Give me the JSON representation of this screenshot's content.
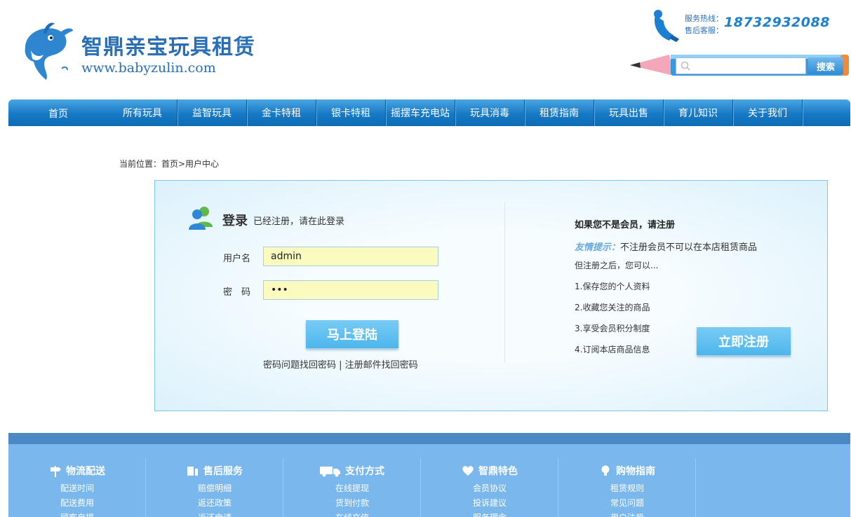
{
  "header": {
    "brand_title": "智鼎亲宝玩具租赁",
    "brand_url": "www.babyzulin.com",
    "hotline_label": "服务热线：",
    "aftersale_label": "售后客服：",
    "hotline_number": "18732932088",
    "search_placeholder": "",
    "search_button": "搜索"
  },
  "nav": {
    "items": [
      "首页",
      "所有玩具",
      "益智玩具",
      "金卡特租",
      "银卡特租",
      "摇摆车充电站",
      "玩具消毒",
      "租赁指南",
      "玩具出售",
      "育儿知识",
      "关于我们"
    ]
  },
  "breadcrumb": "当前位置：首页>用户中心",
  "login": {
    "title": "登录",
    "subtitle": "已经注册，请在此登录",
    "username_label": "用户名",
    "username_value": "admin",
    "password_label": "密　码",
    "password_value": "•••",
    "submit": "马上登陆",
    "recover": "密码问题找回密码 | 注册邮件找回密码"
  },
  "register": {
    "title": "如果您不是会员，请注册",
    "tip_label": "友情提示：",
    "tip_text": "不注册会员不可以在本店租赁商品",
    "tip_line2": "但注册之后，您可以...",
    "benefits": [
      "1.保存您的个人资料",
      "2.收藏您关注的商品",
      "3.享受会员积分制度",
      "4.订阅本店商品信息"
    ],
    "button": "立即注册"
  },
  "footer": {
    "columns": [
      {
        "title": "物流配送",
        "icon": "signpost-icon",
        "links": [
          "配送时间",
          "配送费用",
          "顾客自提"
        ]
      },
      {
        "title": "售后服务",
        "icon": "service-icon",
        "links": [
          "赔偿明细",
          "返还政策",
          "返还申请"
        ]
      },
      {
        "title": "支付方式",
        "icon": "truck-icon",
        "links": [
          "在线提现",
          "货到付款",
          "在线充值"
        ]
      },
      {
        "title": "智鼎特色",
        "icon": "heart-icon",
        "links": [
          "会员协议",
          "投诉建议",
          "服务理念"
        ]
      },
      {
        "title": "购物指南",
        "icon": "bulb-icon",
        "links": [
          "租赁规则",
          "常见问题",
          "用户注册"
        ]
      }
    ]
  }
}
